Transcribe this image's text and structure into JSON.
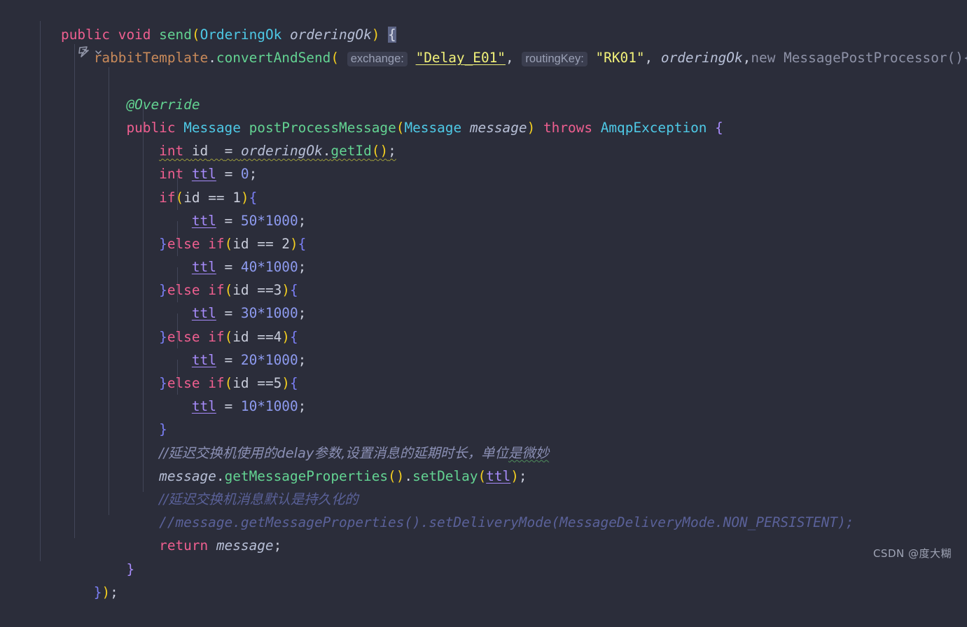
{
  "editor": {
    "background": "#2b2d3a",
    "language": "Java",
    "watermark": "CSDN @度大糊",
    "intention_icon": "lambda-convert-icon",
    "intention_chevron": "chevron-down-icon",
    "indent_guides_x": [
      57,
      106,
      155,
      204,
      253,
      302
    ]
  },
  "code": {
    "line1": {
      "kw_public": "public",
      "sp1": " ",
      "kw_void": "void",
      "sp2": " ",
      "method": "send",
      "paren_open": "(",
      "type_arg": "OrderingOk",
      "sp3": " ",
      "param": "orderingOk",
      "paren_close": ")",
      "sp4": " ",
      "brace": "{"
    },
    "line2": {
      "indent": "    ",
      "field": "rabbitTemplate",
      "dot": ".",
      "method": "convertAndSend",
      "paren_open": "(",
      "sp_a": " ",
      "hint_exchange": "exchange:",
      "sp_b": " ",
      "str_exchange": "\"Delay_E01\"",
      "comma1": ", ",
      "hint_routingkey": "routingKey:",
      "sp_c": " ",
      "str_routingkey": "\"RK01\"",
      "comma2": ", ",
      "arg_orderingok": "orderingOk",
      "comma3": ",",
      "kw_new": "new",
      "sp_d": " ",
      "type_mpp": "MessagePostProcessor()",
      "brace": "{"
    },
    "line3_icon": "lambda-convert-icon",
    "line4": {
      "indent": "        ",
      "annotation": "@Override"
    },
    "line5": {
      "indent": "        ",
      "kw_public": "public",
      "type_return": "Message",
      "method": "postProcessMessage",
      "paren_open": "(",
      "type_param": "Message",
      "param": "message",
      "paren_close": ")",
      "kw_throws": "throws",
      "type_ex": "AmqpException",
      "brace": "{"
    },
    "line6": {
      "indent": "            ",
      "kw_int": "int",
      "var_id": "id",
      "eq": "=",
      "obj": "orderingOk",
      "dot": ".",
      "call": "getId",
      "parens": "()",
      "semi": ";"
    },
    "line7": {
      "indent": "            ",
      "kw_int": "int",
      "var": "ttl",
      "eq": " = ",
      "num": "0",
      "semi": ";"
    },
    "line8": {
      "indent": "            ",
      "kw_if": "if",
      "paren_open": "(",
      "cond": "id == 1",
      "paren_close": ")",
      "brace": "{"
    },
    "line9": {
      "indent": "                ",
      "var": "ttl",
      "eq": " = ",
      "expr": "50*1000",
      "semi": ";"
    },
    "line10": {
      "indent": "            ",
      "close": "}",
      "kw_else": "else ",
      "kw_if": "if",
      "paren_open": "(",
      "cond": "id == 2",
      "paren_close": ")",
      "brace": "{"
    },
    "line11": {
      "indent": "                ",
      "var": "ttl",
      "eq": " = ",
      "expr": "40*1000",
      "semi": ";"
    },
    "line12": {
      "indent": "            ",
      "close": "}",
      "kw_else": "else ",
      "kw_if": "if",
      "paren_open": "(",
      "cond": "id ==3",
      "paren_close": ")",
      "brace": "{"
    },
    "line13": {
      "indent": "                ",
      "var": "ttl",
      "eq": " = ",
      "expr": "30*1000",
      "semi": ";"
    },
    "line14": {
      "indent": "            ",
      "close": "}",
      "kw_else": "else ",
      "kw_if": "if",
      "paren_open": "(",
      "cond": "id ==4",
      "paren_close": ")",
      "brace": "{"
    },
    "line15": {
      "indent": "                ",
      "var": "ttl",
      "eq": " = ",
      "expr": "20*1000",
      "semi": ";"
    },
    "line16": {
      "indent": "            ",
      "close": "}",
      "kw_else": "else ",
      "kw_if": "if",
      "paren_open": "(",
      "cond": "id ==5",
      "paren_close": ")",
      "brace": "{"
    },
    "line17": {
      "indent": "                ",
      "var": "ttl",
      "eq": " = ",
      "expr": "10*1000",
      "semi": ";"
    },
    "line18": {
      "indent": "            ",
      "close": "}"
    },
    "line19": {
      "indent": "            ",
      "comment_head": "//延迟交换机使用的delay参数,设置消息的延期时长，单位",
      "comment_typo": "是微妙"
    },
    "line20": {
      "indent": "            ",
      "obj": "message",
      "dot1": ".",
      "call1": "getMessageProperties",
      "parens1": "()",
      "dot2": ".",
      "call2": "setDelay",
      "paren_open": "(",
      "arg": "ttl",
      "paren_close": ")",
      "semi": ";"
    },
    "line21": {
      "indent": "            ",
      "comment": "//延迟交换机消息默认是持久化的"
    },
    "line22": {
      "indent": "            ",
      "comment": "//message.getMessageProperties().setDeliveryMode(MessageDeliveryMode.NON_PERSISTENT);"
    },
    "line23": {
      "indent": "            ",
      "kw_return": "return",
      "sp": " ",
      "var": "message",
      "semi": ";"
    },
    "line24": {
      "indent": "        ",
      "close": "}"
    },
    "line25": {
      "indent": "    ",
      "close": "}",
      "paren": ")",
      "semi": ";"
    }
  }
}
